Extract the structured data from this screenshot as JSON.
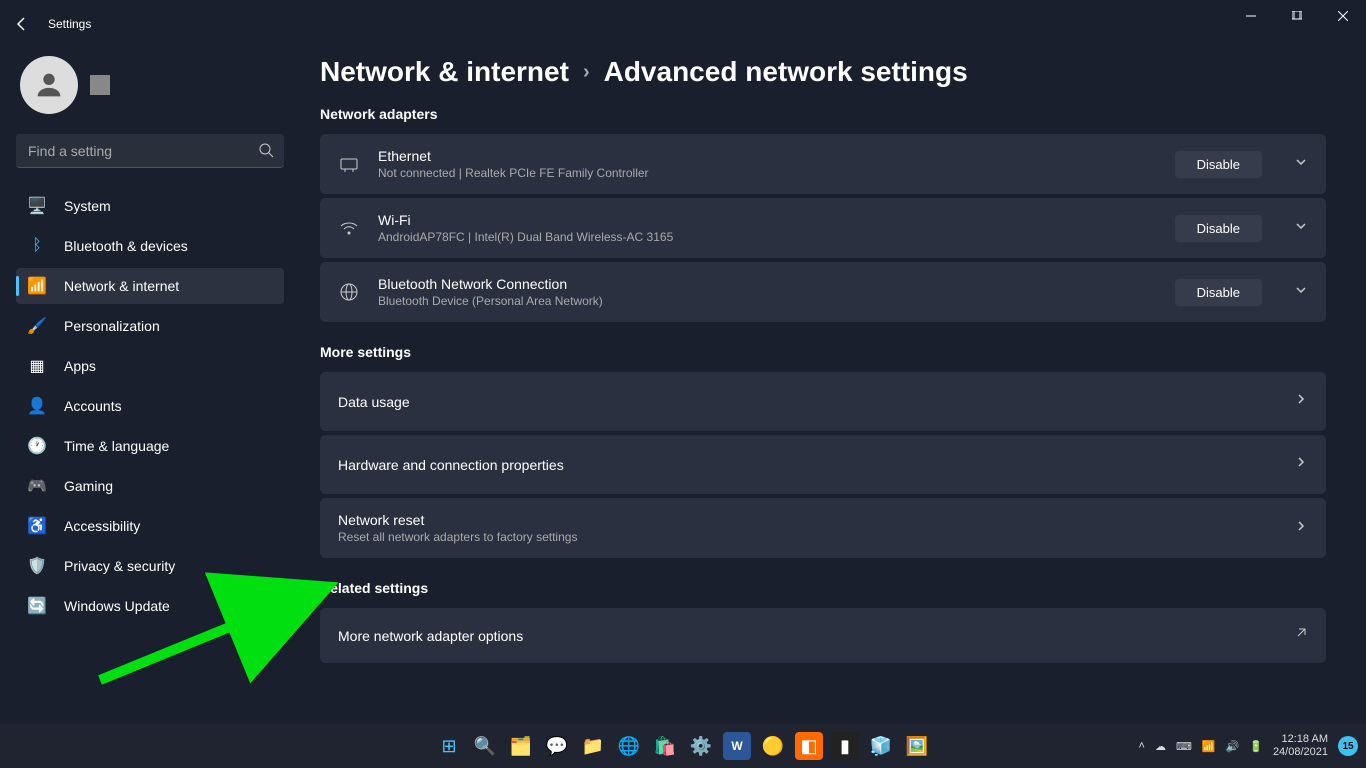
{
  "window": {
    "title": "Settings"
  },
  "search": {
    "placeholder": "Find a setting"
  },
  "nav": {
    "items": [
      {
        "label": "System"
      },
      {
        "label": "Bluetooth & devices"
      },
      {
        "label": "Network & internet"
      },
      {
        "label": "Personalization"
      },
      {
        "label": "Apps"
      },
      {
        "label": "Accounts"
      },
      {
        "label": "Time & language"
      },
      {
        "label": "Gaming"
      },
      {
        "label": "Accessibility"
      },
      {
        "label": "Privacy & security"
      },
      {
        "label": "Windows Update"
      }
    ]
  },
  "breadcrumb": {
    "parent": "Network & internet",
    "current": "Advanced network settings"
  },
  "sections": {
    "adapters_label": "Network adapters",
    "more_label": "More settings",
    "related_label": "Related settings"
  },
  "adapters": [
    {
      "title": "Ethernet",
      "sub": "Not connected | Realtek PCIe FE Family Controller",
      "action": "Disable"
    },
    {
      "title": "Wi-Fi",
      "sub": "AndroidAP78FC | Intel(R) Dual Band Wireless-AC 3165",
      "action": "Disable"
    },
    {
      "title": "Bluetooth Network Connection",
      "sub": "Bluetooth Device (Personal Area Network)",
      "action": "Disable"
    }
  ],
  "more": [
    {
      "title": "Data usage",
      "sub": ""
    },
    {
      "title": "Hardware and connection properties",
      "sub": ""
    },
    {
      "title": "Network reset",
      "sub": "Reset all network adapters to factory settings"
    }
  ],
  "related": [
    {
      "title": "More network adapter options"
    }
  ],
  "tray": {
    "time": "12:18 AM",
    "date": "24/08/2021",
    "badge": "15"
  }
}
